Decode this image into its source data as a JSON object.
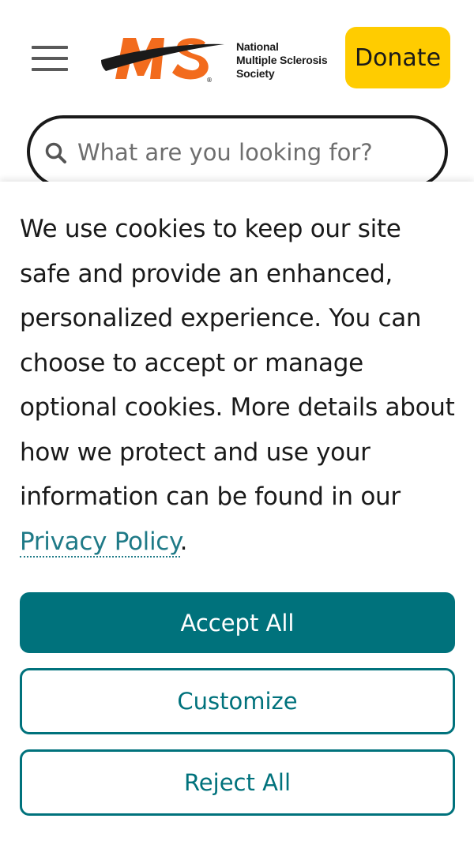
{
  "header": {
    "menu_icon": "hamburger-menu-icon",
    "logo": {
      "mark": "MS",
      "lines": [
        "National",
        "Multiple Sclerosis",
        "Society"
      ],
      "registered": "®",
      "colors": {
        "mark": "#f26b1d",
        "swoosh": "#1a1a1a"
      }
    },
    "donate_label": "Donate"
  },
  "search": {
    "icon": "search-icon",
    "placeholder": "What are you looking for?",
    "value": ""
  },
  "cookie_banner": {
    "text_before": "We use cookies to keep our site safe and provide an enhanced, personalized experience. You can choose to accept or manage optional cookies. More details about how we protect and use your information can be found in our ",
    "privacy_link": "Privacy Policy",
    "text_after": ".",
    "accept_label": "Accept All",
    "customize_label": "Customize",
    "reject_label": "Reject All"
  },
  "colors": {
    "accent": "#00727c",
    "donate": "#ffcc00",
    "link": "#1f7a87",
    "brand_orange": "#f26b1d"
  }
}
